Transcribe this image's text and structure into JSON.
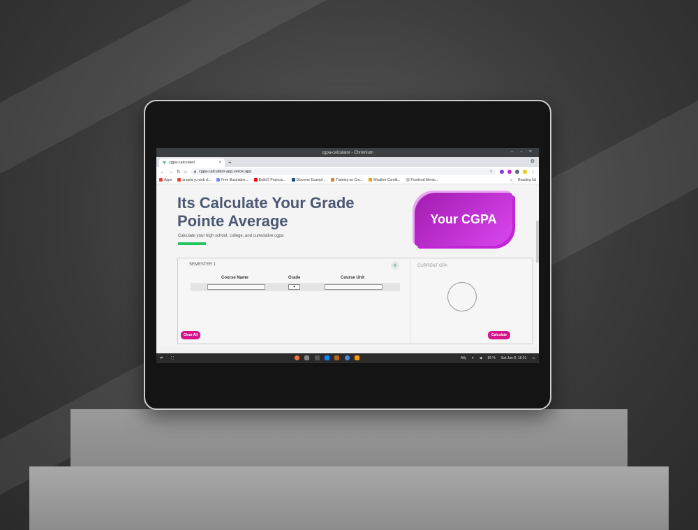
{
  "window": {
    "title": "cgpa-calculator - Chromium",
    "controls": "– ▫ ×"
  },
  "tab": {
    "title": "cgpa-calculator",
    "close": "×",
    "new": "+"
  },
  "address": {
    "url": "cgpa-calculator-app.vercel.app"
  },
  "bookmarks": {
    "items": [
      {
        "label": "Apps",
        "color": "#ea4335"
      },
      {
        "label": "angela yu web d...",
        "color": "#ea4335"
      },
      {
        "label": "Free Illustration...",
        "color": "#7c83fd"
      },
      {
        "label": "Build 5 Projects...",
        "color": "#ff0000"
      },
      {
        "label": "Discover Exampl...",
        "color": "#1f4e79"
      },
      {
        "label": "Training on Cre...",
        "color": "#e67e22"
      },
      {
        "label": "Weather Condit...",
        "color": "#f39c12"
      },
      {
        "label": "Frontend Mento...",
        "color": "#bdc3c7"
      }
    ],
    "more": "»",
    "reading_list": "Reading list"
  },
  "page": {
    "title_line1": "Its Calculate Your Grade",
    "title_line2": "Pointe Average",
    "subtitle": "Calculate your high school, college, and cumulative cgpa",
    "badge": "Your CGPA",
    "semester_label": "SEMESTER 1",
    "add": "+",
    "col_course_name": "Course Name",
    "col_grade": "Grade",
    "col_course_unit": "Course Unit",
    "current_gpa_label": "CURRENT GPA",
    "clear_all": "Clear All",
    "calculate": "Calculate"
  },
  "taskbar": {
    "network": "Ally",
    "battery": "89 %",
    "datetime": "Sat Jan 8, 18:21"
  },
  "colors": {
    "accent": "#d6158b",
    "badge_start": "#a21caf",
    "badge_end": "#d946ef",
    "heading": "#4c5873",
    "green_bar": "#22c55e"
  }
}
